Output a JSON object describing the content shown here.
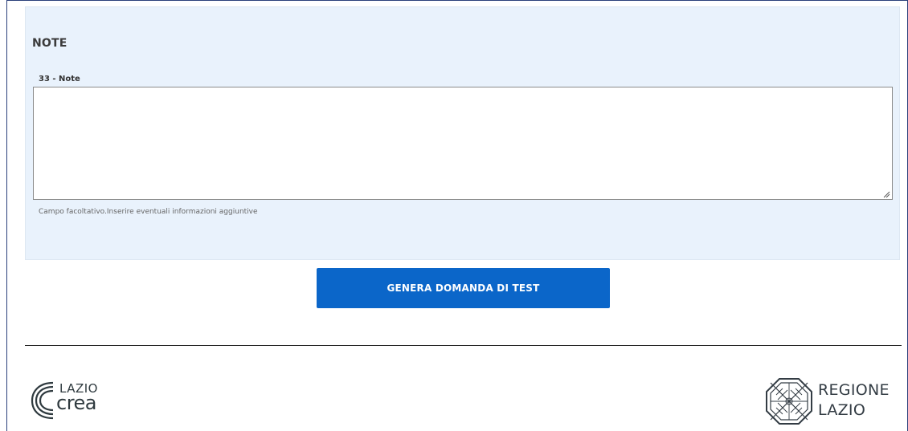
{
  "section": {
    "title": "NOTE"
  },
  "note_field": {
    "label": "33 - Note",
    "value": "",
    "help_text": "Campo facoltativo.Inserire eventuali informazioni aggiuntive"
  },
  "actions": {
    "generate_label": "GENERA DOMANDA DI TEST"
  },
  "footer": {
    "left_logo_top": "LAZIO",
    "left_logo_bottom": "crea",
    "right_logo_line1": "REGIONE",
    "right_logo_line2": "LAZIO"
  },
  "colors": {
    "panel_bg": "#e9f2fc",
    "button_bg": "#0b66c9",
    "button_text": "#ffffff",
    "frame_border": "#2a3f7a"
  },
  "icons": {
    "resize_handle": "resize-grip-icon",
    "left_logo_mark": "lazio-crea-logo-icon",
    "right_logo_mark": "regione-lazio-crest-icon"
  }
}
